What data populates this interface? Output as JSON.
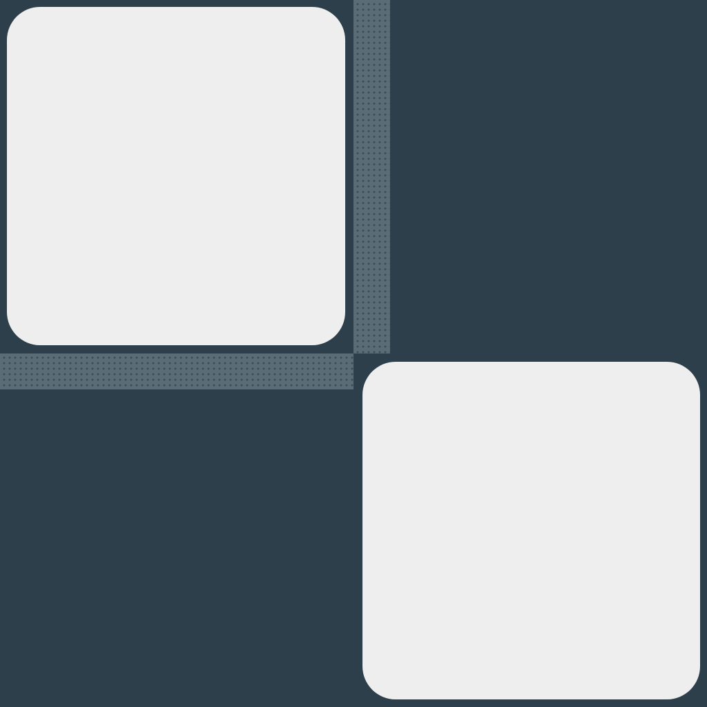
{
  "scene": {
    "colors": {
      "background": "#2d3f4a",
      "tile": "#eeeeee",
      "strip": "#5a6d76",
      "strip_dots": "#3a4c56"
    },
    "tiles": [
      {
        "name": "tile-top-left",
        "text": ""
      },
      {
        "name": "tile-bottom-right",
        "text": ""
      }
    ],
    "strips": [
      {
        "name": "dotted-strip-vertical",
        "pattern": "dots"
      },
      {
        "name": "dotted-strip-horizontal",
        "pattern": "dots"
      }
    ]
  }
}
